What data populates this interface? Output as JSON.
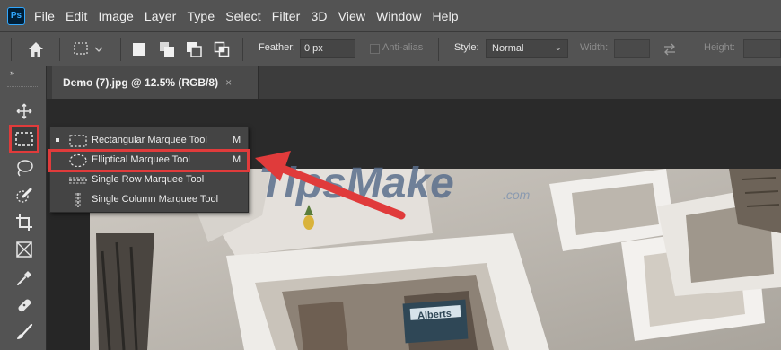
{
  "app": {
    "logo": "Ps"
  },
  "menu": [
    "File",
    "Edit",
    "Image",
    "Layer",
    "Type",
    "Select",
    "Filter",
    "3D",
    "View",
    "Window",
    "Help"
  ],
  "options": {
    "feather_label": "Feather:",
    "feather_value": "0 px",
    "antialias_label": "Anti-alias",
    "style_label": "Style:",
    "style_value": "Normal",
    "width_label": "Width:",
    "height_label": "Height:"
  },
  "document_tab": {
    "title": "Demo (7).jpg @ 12.5% (RGB/8)",
    "close": "×"
  },
  "toolbar": {
    "collapse": "»",
    "tools": [
      "move-tool",
      "marquee-tool",
      "lasso-tool",
      "quick-selection-tool",
      "crop-tool",
      "frame-tool",
      "eyedropper-tool",
      "healing-brush-tool",
      "brush-tool"
    ]
  },
  "marquee_flyout": {
    "items": [
      {
        "label": "Rectangular Marquee Tool",
        "shortcut": "M",
        "icon": "rectangular-marquee-icon",
        "selected": true
      },
      {
        "label": "Elliptical Marquee Tool",
        "shortcut": "M",
        "icon": "elliptical-marquee-icon",
        "selected": false
      },
      {
        "label": "Single Row Marquee Tool",
        "shortcut": "",
        "icon": "single-row-marquee-icon",
        "selected": false
      },
      {
        "label": "Single Column Marquee Tool",
        "shortcut": "",
        "icon": "single-column-marquee-icon",
        "selected": false
      }
    ]
  },
  "canvas_image": {
    "watermark": "TipsMake",
    "watermark_suffix": ".com",
    "sign_text": "Alberts"
  },
  "colors": {
    "highlight": "#e03b3b",
    "panel": "#535353",
    "canvas_bg": "#262626",
    "watermark": "#5a6f8c"
  }
}
